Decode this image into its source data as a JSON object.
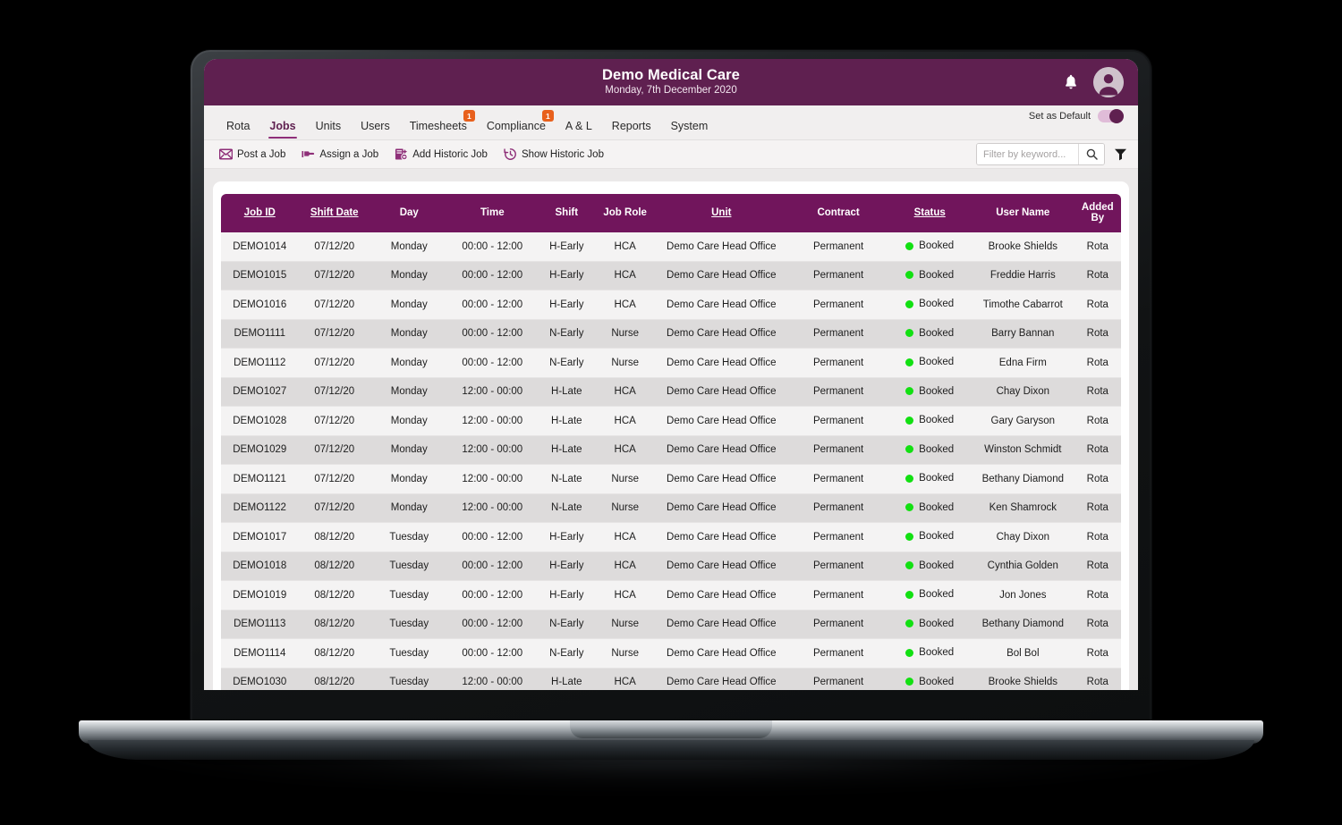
{
  "header": {
    "title": "Demo Medical Care",
    "subtitle": "Monday, 7th December 2020",
    "bell_icon": "bell-icon",
    "avatar_icon": "user-avatar-icon"
  },
  "nav": {
    "items": [
      {
        "label": "Rota",
        "active": false,
        "badge": null
      },
      {
        "label": "Jobs",
        "active": true,
        "badge": null
      },
      {
        "label": "Units",
        "active": false,
        "badge": null
      },
      {
        "label": "Users",
        "active": false,
        "badge": null
      },
      {
        "label": "Timesheets",
        "active": false,
        "badge": "1"
      },
      {
        "label": "Compliance",
        "active": false,
        "badge": "1"
      },
      {
        "label": "A & L",
        "active": false,
        "badge": null
      },
      {
        "label": "Reports",
        "active": false,
        "badge": null
      },
      {
        "label": "System",
        "active": false,
        "badge": null
      }
    ],
    "set_as_default_label": "Set as Default",
    "set_as_default_on": true
  },
  "toolbar": {
    "buttons": [
      {
        "label": "Post a Job",
        "icon": "envelope-icon"
      },
      {
        "label": "Assign a Job",
        "icon": "pointing-hand-icon"
      },
      {
        "label": "Add Historic Job",
        "icon": "document-add-icon"
      },
      {
        "label": "Show Historic Job",
        "icon": "clock-rewind-icon"
      }
    ],
    "search_placeholder": "Filter by keyword...",
    "search_value": "",
    "search_icon": "search-icon",
    "filter_icon": "funnel-icon"
  },
  "table": {
    "columns": [
      {
        "label": "Job ID",
        "sortable": true
      },
      {
        "label": "Shift Date",
        "sortable": true
      },
      {
        "label": "Day",
        "sortable": false
      },
      {
        "label": "Time",
        "sortable": false
      },
      {
        "label": "Shift",
        "sortable": false
      },
      {
        "label": "Job Role",
        "sortable": false
      },
      {
        "label": "Unit",
        "sortable": true
      },
      {
        "label": "Contract",
        "sortable": false
      },
      {
        "label": "Status",
        "sortable": true
      },
      {
        "label": "User Name",
        "sortable": false
      },
      {
        "label": "Added By",
        "sortable": false
      }
    ],
    "rows": [
      {
        "job_id": "DEMO1014",
        "shift_date": "07/12/20",
        "day": "Monday",
        "time": "00:00 - 12:00",
        "shift": "H-Early",
        "job_role": "HCA",
        "unit": "Demo Care Head Office",
        "contract": "Permanent",
        "status": "Booked",
        "user_name": "Brooke Shields",
        "added_by": "Rota"
      },
      {
        "job_id": "DEMO1015",
        "shift_date": "07/12/20",
        "day": "Monday",
        "time": "00:00 - 12:00",
        "shift": "H-Early",
        "job_role": "HCA",
        "unit": "Demo Care Head Office",
        "contract": "Permanent",
        "status": "Booked",
        "user_name": "Freddie Harris",
        "added_by": "Rota"
      },
      {
        "job_id": "DEMO1016",
        "shift_date": "07/12/20",
        "day": "Monday",
        "time": "00:00 - 12:00",
        "shift": "H-Early",
        "job_role": "HCA",
        "unit": "Demo Care Head Office",
        "contract": "Permanent",
        "status": "Booked",
        "user_name": "Timothe Cabarrot",
        "added_by": "Rota"
      },
      {
        "job_id": "DEMO1111",
        "shift_date": "07/12/20",
        "day": "Monday",
        "time": "00:00 - 12:00",
        "shift": "N-Early",
        "job_role": "Nurse",
        "unit": "Demo Care Head Office",
        "contract": "Permanent",
        "status": "Booked",
        "user_name": "Barry Bannan",
        "added_by": "Rota"
      },
      {
        "job_id": "DEMO1112",
        "shift_date": "07/12/20",
        "day": "Monday",
        "time": "00:00 - 12:00",
        "shift": "N-Early",
        "job_role": "Nurse",
        "unit": "Demo Care Head Office",
        "contract": "Permanent",
        "status": "Booked",
        "user_name": "Edna Firm",
        "added_by": "Rota"
      },
      {
        "job_id": "DEMO1027",
        "shift_date": "07/12/20",
        "day": "Monday",
        "time": "12:00 - 00:00",
        "shift": "H-Late",
        "job_role": "HCA",
        "unit": "Demo Care Head Office",
        "contract": "Permanent",
        "status": "Booked",
        "user_name": "Chay Dixon",
        "added_by": "Rota"
      },
      {
        "job_id": "DEMO1028",
        "shift_date": "07/12/20",
        "day": "Monday",
        "time": "12:00 - 00:00",
        "shift": "H-Late",
        "job_role": "HCA",
        "unit": "Demo Care Head Office",
        "contract": "Permanent",
        "status": "Booked",
        "user_name": "Gary Garyson",
        "added_by": "Rota"
      },
      {
        "job_id": "DEMO1029",
        "shift_date": "07/12/20",
        "day": "Monday",
        "time": "12:00 - 00:00",
        "shift": "H-Late",
        "job_role": "HCA",
        "unit": "Demo Care Head Office",
        "contract": "Permanent",
        "status": "Booked",
        "user_name": "Winston Schmidt",
        "added_by": "Rota"
      },
      {
        "job_id": "DEMO1121",
        "shift_date": "07/12/20",
        "day": "Monday",
        "time": "12:00 - 00:00",
        "shift": "N-Late",
        "job_role": "Nurse",
        "unit": "Demo Care Head Office",
        "contract": "Permanent",
        "status": "Booked",
        "user_name": "Bethany Diamond",
        "added_by": "Rota"
      },
      {
        "job_id": "DEMO1122",
        "shift_date": "07/12/20",
        "day": "Monday",
        "time": "12:00 - 00:00",
        "shift": "N-Late",
        "job_role": "Nurse",
        "unit": "Demo Care Head Office",
        "contract": "Permanent",
        "status": "Booked",
        "user_name": "Ken Shamrock",
        "added_by": "Rota"
      },
      {
        "job_id": "DEMO1017",
        "shift_date": "08/12/20",
        "day": "Tuesday",
        "time": "00:00 - 12:00",
        "shift": "H-Early",
        "job_role": "HCA",
        "unit": "Demo Care Head Office",
        "contract": "Permanent",
        "status": "Booked",
        "user_name": "Chay Dixon",
        "added_by": "Rota"
      },
      {
        "job_id": "DEMO1018",
        "shift_date": "08/12/20",
        "day": "Tuesday",
        "time": "00:00 - 12:00",
        "shift": "H-Early",
        "job_role": "HCA",
        "unit": "Demo Care Head Office",
        "contract": "Permanent",
        "status": "Booked",
        "user_name": "Cynthia Golden",
        "added_by": "Rota"
      },
      {
        "job_id": "DEMO1019",
        "shift_date": "08/12/20",
        "day": "Tuesday",
        "time": "00:00 - 12:00",
        "shift": "H-Early",
        "job_role": "HCA",
        "unit": "Demo Care Head Office",
        "contract": "Permanent",
        "status": "Booked",
        "user_name": "Jon Jones",
        "added_by": "Rota"
      },
      {
        "job_id": "DEMO1113",
        "shift_date": "08/12/20",
        "day": "Tuesday",
        "time": "00:00 - 12:00",
        "shift": "N-Early",
        "job_role": "Nurse",
        "unit": "Demo Care Head Office",
        "contract": "Permanent",
        "status": "Booked",
        "user_name": "Bethany Diamond",
        "added_by": "Rota"
      },
      {
        "job_id": "DEMO1114",
        "shift_date": "08/12/20",
        "day": "Tuesday",
        "time": "00:00 - 12:00",
        "shift": "N-Early",
        "job_role": "Nurse",
        "unit": "Demo Care Head Office",
        "contract": "Permanent",
        "status": "Booked",
        "user_name": "Bol Bol",
        "added_by": "Rota"
      },
      {
        "job_id": "DEMO1030",
        "shift_date": "08/12/20",
        "day": "Tuesday",
        "time": "12:00 - 00:00",
        "shift": "H-Late",
        "job_role": "HCA",
        "unit": "Demo Care Head Office",
        "contract": "Permanent",
        "status": "Booked",
        "user_name": "Brooke Shields",
        "added_by": "Rota"
      }
    ]
  },
  "colors": {
    "brand_purple": "#5F2050",
    "table_header_purple": "#71155C",
    "badge_orange": "#E8601C",
    "link_blue": "#2B90D9",
    "status_green": "#12E012"
  }
}
